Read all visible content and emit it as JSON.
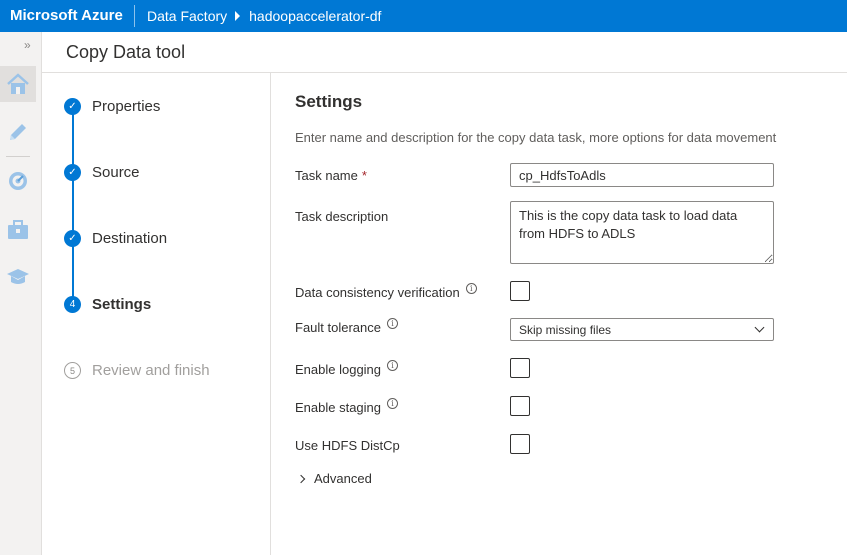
{
  "topbar": {
    "brand": "Microsoft Azure",
    "breadcrumb": [
      "Data Factory",
      "hadoopaccelerator-df"
    ],
    "background": "#0078d4"
  },
  "rail": {
    "icons": [
      "home-icon",
      "pencil-icon",
      "monitor-icon",
      "manage-icon",
      "learn-icon"
    ]
  },
  "page": {
    "title": "Copy Data tool"
  },
  "steps": [
    {
      "number": "✓",
      "label": "Properties",
      "state": "completed"
    },
    {
      "number": "✓",
      "label": "Source",
      "state": "completed"
    },
    {
      "number": "✓",
      "label": "Destination",
      "state": "completed"
    },
    {
      "number": "4",
      "label": "Settings",
      "state": "current"
    },
    {
      "number": "5",
      "label": "Review and finish",
      "state": "future"
    }
  ],
  "settings": {
    "title": "Settings",
    "description": "Enter name and description for the copy data task, more options for data movement",
    "task_name": {
      "label": "Task name",
      "required_mark": "*",
      "value": "cp_HdfsToAdls"
    },
    "task_description": {
      "label": "Task description",
      "value": "This is the copy data task to load data from HDFS to ADLS"
    },
    "data_consistency": {
      "label": "Data consistency verification",
      "checked": false
    },
    "fault_tolerance": {
      "label": "Fault tolerance",
      "value": "Skip missing files"
    },
    "enable_logging": {
      "label": "Enable logging",
      "checked": false
    },
    "enable_staging": {
      "label": "Enable staging",
      "checked": false
    },
    "use_hdfs_distcp": {
      "label": "Use HDFS DistCp",
      "checked": false
    },
    "advanced": {
      "label": "Advanced"
    },
    "info_glyph": "i"
  },
  "colors": {
    "accent": "#0078d4",
    "required": "#a4262c"
  }
}
